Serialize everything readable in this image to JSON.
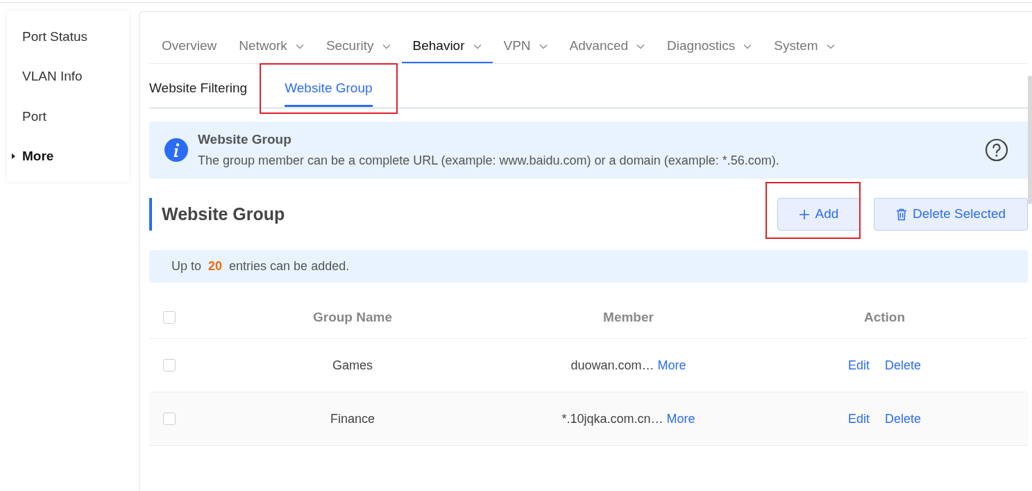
{
  "sidebar": {
    "items": [
      {
        "label": "Port Status",
        "kind": "link"
      },
      {
        "label": "VLAN Info",
        "kind": "link"
      },
      {
        "label": "Port",
        "kind": "link"
      },
      {
        "label": "More",
        "kind": "group",
        "expanded": false
      }
    ]
  },
  "nav_tabs": [
    {
      "label": "Overview",
      "selected": false,
      "has_menu": false
    },
    {
      "label": "Network",
      "selected": false,
      "has_menu": true
    },
    {
      "label": "Security",
      "selected": false,
      "has_menu": true
    },
    {
      "label": "Behavior",
      "selected": true,
      "has_menu": true
    },
    {
      "label": "VPN",
      "selected": false,
      "has_menu": true
    },
    {
      "label": "Advanced",
      "selected": false,
      "has_menu": true
    },
    {
      "label": "Diagnostics",
      "selected": false,
      "has_menu": true
    },
    {
      "label": "System",
      "selected": false,
      "has_menu": true
    }
  ],
  "sub_tabs": [
    {
      "label": "Website Filtering",
      "selected": false,
      "highlighted": false
    },
    {
      "label": "Website Group",
      "selected": true,
      "highlighted": true
    }
  ],
  "info_banner": {
    "title": "Website Group",
    "text": "The group member can be a complete URL (example: www.baidu.com) or a domain (example: *.56.com)."
  },
  "section": {
    "title": "Website Group",
    "buttons": [
      {
        "label": "Add",
        "kind": "add",
        "highlighted": true
      },
      {
        "label": "Delete Selected",
        "kind": "delete",
        "highlighted": false
      }
    ]
  },
  "notice": {
    "prefix": "Up to",
    "count": "20",
    "suffix": "entries can be added."
  },
  "table": {
    "columns": [
      "Group Name",
      "Member",
      "Action"
    ],
    "header_checked": false,
    "rows": [
      {
        "checked": false,
        "name": "Games",
        "member": "duowan.com…",
        "more": "More",
        "actions": [
          "Edit",
          "Delete"
        ]
      },
      {
        "checked": false,
        "name": "Finance",
        "member": "*.10jqka.com.cn…",
        "more": "More",
        "actions": [
          "Edit",
          "Delete"
        ]
      }
    ]
  }
}
